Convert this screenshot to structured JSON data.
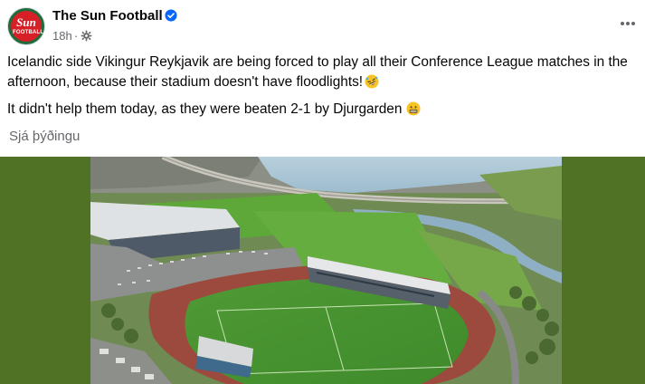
{
  "post": {
    "page_name": "The Sun Football",
    "timestamp": "18h",
    "separator": "·",
    "avatar": {
      "logo_word": "Sun",
      "logo_sub": "FOOTBALL"
    },
    "text_lines": [
      "Icelandic side Vikingur Reykjavik are being forced to play all their Conference League matches in the afternoon, because their stadium doesn't have floodlights!",
      "It didn't help them today, as they were beaten 2-1 by Djurgarden"
    ],
    "see_translation": "Sjá þýðingu",
    "image": {
      "description_icon": "stadium-aerial-photo"
    }
  },
  "icons": [
    "verified-badge-icon",
    "audience-gear-icon",
    "more-options-icon",
    "rofl-emoji-icon",
    "grimace-emoji-icon"
  ],
  "colors": {
    "text_primary": "#050505",
    "text_secondary": "#65676b",
    "verified_blue": "#0866ff",
    "media_background": "#4f7224",
    "brand_red": "#d61f26"
  }
}
